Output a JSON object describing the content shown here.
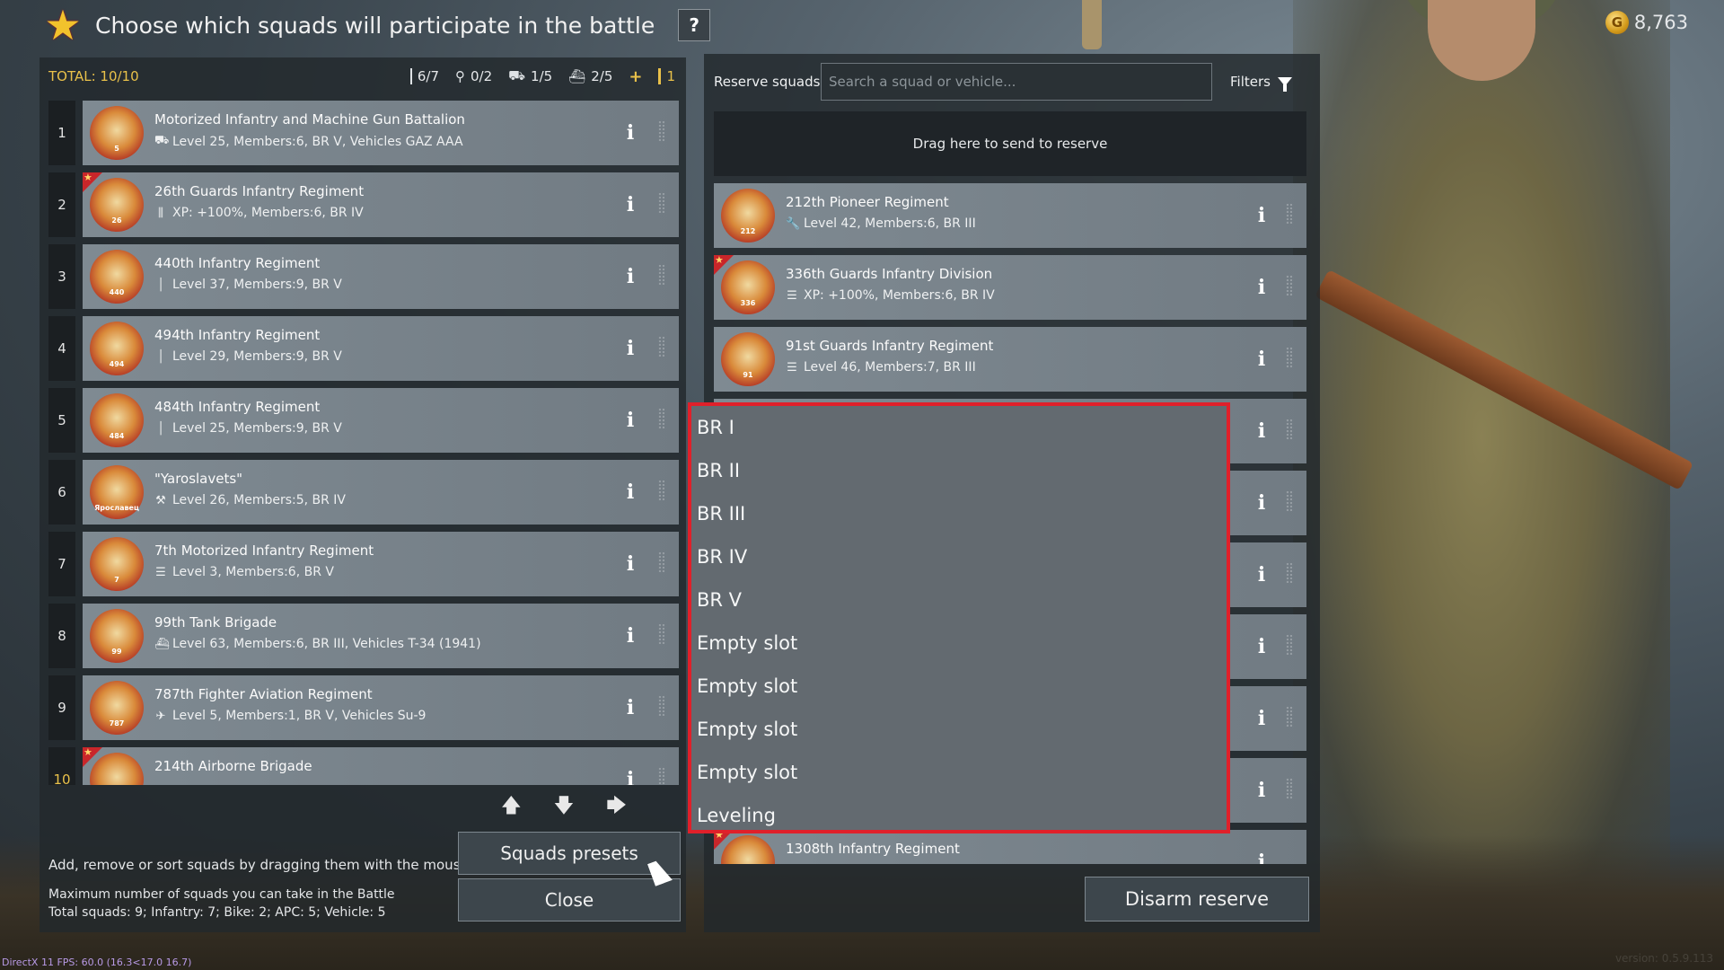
{
  "header": {
    "title": "Choose which squads will participate in the battle",
    "help_label": "?",
    "gold": "8,763"
  },
  "left_panel": {
    "total": "TOTAL: 10/10",
    "caps": [
      {
        "icon": "infantry-icon",
        "value": "6/7"
      },
      {
        "icon": "bike-icon",
        "value": "0/2"
      },
      {
        "icon": "apc-icon",
        "value": "1/5"
      },
      {
        "icon": "vehicle-icon",
        "value": "2/5"
      },
      {
        "icon": "plus-icon",
        "value": "+"
      },
      {
        "icon": "extra-icon",
        "value": "1"
      }
    ],
    "squads": [
      {
        "n": "1",
        "name": "Motorized Infantry and Machine Gun Battalion",
        "details": "Level 25, Members:6, BR V, Vehicles GAZ AAA",
        "badge": "5",
        "flag": false
      },
      {
        "n": "2",
        "name": "26th Guards Infantry Regiment",
        "details": "XP: +100%, Members:6, BR IV",
        "badge": "26",
        "flag": true
      },
      {
        "n": "3",
        "name": "440th Infantry Regiment",
        "details": "Level 37, Members:9, BR V",
        "badge": "440",
        "flag": false
      },
      {
        "n": "4",
        "name": "494th Infantry Regiment",
        "details": "Level 29, Members:9, BR V",
        "badge": "494",
        "flag": false
      },
      {
        "n": "5",
        "name": "484th Infantry Regiment",
        "details": "Level 25, Members:9, BR V",
        "badge": "484",
        "flag": false
      },
      {
        "n": "6",
        "name": "\"Yaroslavets\"",
        "details": "Level 26, Members:5, BR IV",
        "badge": "Ярославец",
        "flag": false
      },
      {
        "n": "7",
        "name": "7th Motorized Infantry Regiment",
        "details": "Level 3, Members:6, BR V",
        "badge": "7",
        "flag": false
      },
      {
        "n": "8",
        "name": "99th Tank Brigade",
        "details": "Level 63, Members:6, BR III, Vehicles T-34 (1941)",
        "badge": "99",
        "flag": false
      },
      {
        "n": "9",
        "name": "787th Fighter Aviation Regiment",
        "details": "Level 5, Members:1, BR V, Vehicles Su-9",
        "badge": "787",
        "flag": false
      },
      {
        "n": "10",
        "name": "214th Airborne Brigade",
        "details": "",
        "badge": "",
        "flag": true
      }
    ],
    "help_text": "Add, remove or sort squads by dragging them with the mouse.",
    "max_title": "Maximum number of squads you can take in the Battle",
    "max_detail": "Total squads: 9; Infantry: 7; Bike: 2; APC: 5; Vehicle: 5",
    "presets_label": "Squads presets",
    "close_label": "Close"
  },
  "right_panel": {
    "label": "Reserve squads",
    "search_placeholder": "Search a squad or vehicle...",
    "filters_label": "Filters",
    "dropzone": "Drag here to send to reserve",
    "squads": [
      {
        "name": "212th Pioneer Regiment",
        "details": "Level 42, Members:6, BR III",
        "badge": "212",
        "flag": false
      },
      {
        "name": "336th Guards Infantry Division",
        "details": "XP: +100%, Members:6, BR IV",
        "badge": "336",
        "flag": true
      },
      {
        "name": "91st Guards Infantry Regiment",
        "details": "Level 46, Members:7, BR III",
        "badge": "91",
        "flag": false
      },
      {
        "name": "1308th Infantry Regiment",
        "details": "",
        "badge": "",
        "flag": true
      }
    ],
    "disarm_label": "Disarm reserve"
  },
  "dropdown": {
    "options": [
      "BR I",
      "BR II",
      "BR III",
      "BR IV",
      "BR V",
      "Empty slot",
      "Empty slot",
      "Empty slot",
      "Empty slot",
      "Leveling"
    ]
  },
  "footer": {
    "fps": "DirectX 11 FPS: 60.0 (16.3<17.0 16.7)",
    "version": "version: 0.5.9.113"
  },
  "colors": {
    "accent": "#e9c14a",
    "highlight": "#e0202a",
    "card": "#7f8a92"
  }
}
